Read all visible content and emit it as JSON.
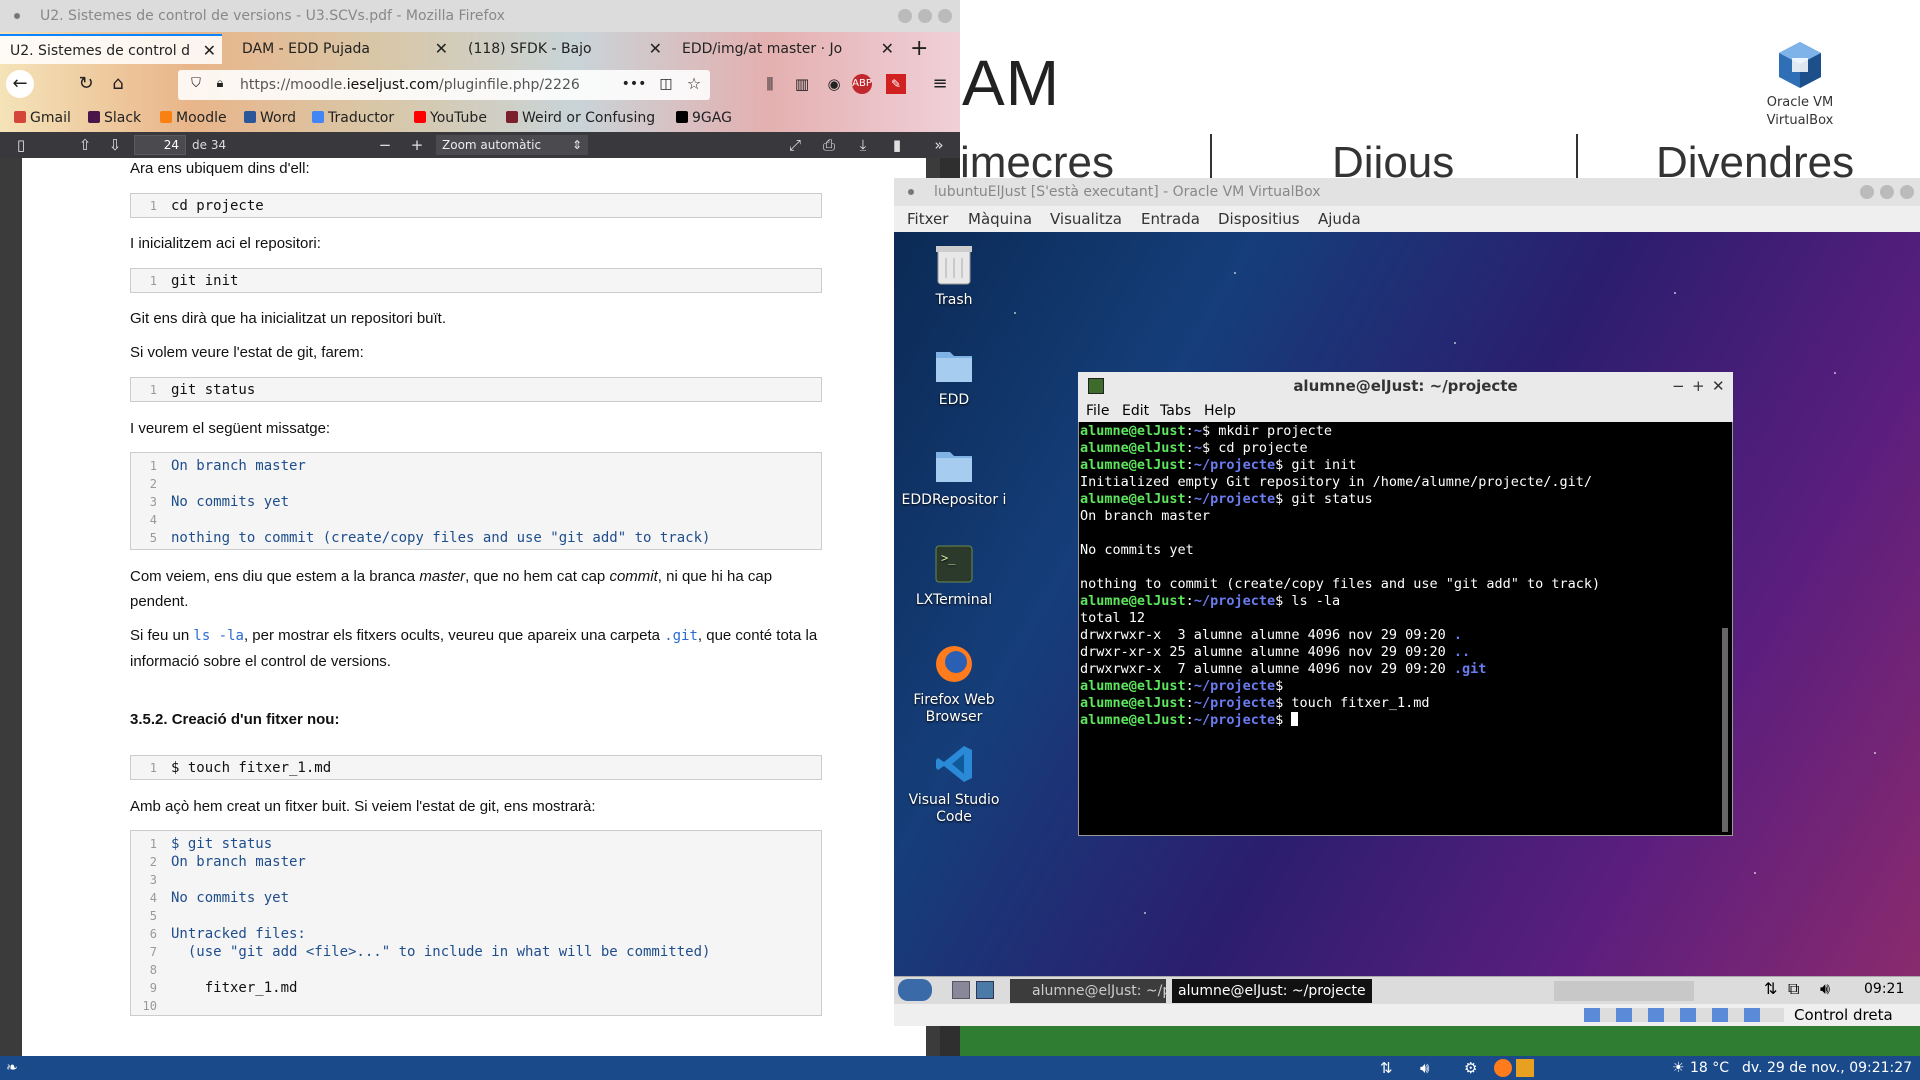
{
  "background": {
    "title_fragment": "AM",
    "days": [
      "imecres",
      "Dijous",
      "Divendres"
    ],
    "vbox_icon_label_1": "Oracle VM",
    "vbox_icon_label_2": "VirtualBox"
  },
  "firefox": {
    "window_title": "U2. Sistemes de control de versions - U3.SCVs.pdf - Mozilla Firefox",
    "tabs": [
      {
        "label": "U2. Sistemes de control d"
      },
      {
        "label": "DAM - EDD Pujada"
      },
      {
        "label": "(118) SFDK - Bajo"
      },
      {
        "label": "EDD/img/at master · Jo"
      }
    ],
    "url_prefix": "https://moodle.",
    "url_domain": "ieseljust.com",
    "url_suffix": "/pluginfile.php/2226",
    "url_more": "•••",
    "bookmarks": [
      "Gmail",
      "Slack",
      "Moodle",
      "Word",
      "Traductor",
      "YouTube",
      "Weird or Confusing",
      "9GAG"
    ]
  },
  "pdf": {
    "page_number": "24",
    "page_count": "de 34",
    "zoom": "Zoom automàtic",
    "p1": "Ara ens ubiquem dins d'ell:",
    "code1": "cd projecte",
    "p2": "I inicialitzem aci el repositori:",
    "code2": "git init",
    "p3": "Git ens dirà que ha inicialitzat un repositori buït.",
    "p4": "Si volem veure l'estat de git, farem:",
    "code3": "git status",
    "p5": "I veurem el següent missatge:",
    "code4": [
      "On branch master",
      "",
      "No commits yet",
      "",
      "nothing to commit (create/copy files and use \"git add\" to track)"
    ],
    "p6a": "Com veiem, ens diu que estem a la branca ",
    "p6b": "master",
    "p6c": ", que no hem cat cap ",
    "p6d": "commit",
    "p6e": ", ni que hi ha cap pendent.",
    "p7a": "Si feu un ",
    "p7b": "ls -la",
    "p7c": ", per mostrar els fitxers ocults, veureu que apareix una carpeta ",
    "p7d": ".git",
    "p7e": ", que conté tota la informació sobre el control de versions.",
    "heading": "3.5.2. Creació d'un fitxer nou:",
    "code5": "$ touch fitxer_1.md",
    "p8": "Amb açò hem creat un fitxer buit. Si veiem l'estat de git, ens mostrarà:",
    "code6": [
      "$ git status",
      "On branch master",
      "",
      "No commits yet",
      "",
      "Untracked files:",
      "  (use \"git add <file>...\" to include in what will be committed)",
      "",
      "    fitxer_1.md",
      ""
    ]
  },
  "vbox": {
    "window_title": "lubuntuElJust [S'està executant] - Oracle VM VirtualBox",
    "menu": [
      "Fitxer",
      "Màquina",
      "Visualitza",
      "Entrada",
      "Dispositius",
      "Ajuda"
    ],
    "desktop_icons": [
      {
        "label": "Trash"
      },
      {
        "label": "EDD"
      },
      {
        "label": "EDDRepositor i"
      },
      {
        "label": "LXTerminal"
      },
      {
        "label": "Firefox Web Browser"
      },
      {
        "label": "Visual Studio Code"
      }
    ],
    "taskbar_item": "alumne@elJust: ~/pr",
    "taskbar_tooltip": "alumne@elJust: ~/projecte",
    "guest_clock": "09:21",
    "host_key": "Control dreta"
  },
  "terminal": {
    "title": "alumne@elJust: ~/projecte",
    "menu": [
      "File",
      "Edit",
      "Tabs",
      "Help"
    ],
    "prompt_user": "alumne@elJust",
    "lines": [
      {
        "type": "cmd",
        "path": "~",
        "cmd": "$ mkdir projecte"
      },
      {
        "type": "cmd",
        "path": "~",
        "cmd": "$ cd projecte"
      },
      {
        "type": "cmd",
        "path": "~/projecte",
        "cmd": "$ git init"
      },
      {
        "type": "out",
        "text": "Initialized empty Git repository in /home/alumne/projecte/.git/"
      },
      {
        "type": "cmd",
        "path": "~/projecte",
        "cmd": "$ git status"
      },
      {
        "type": "out",
        "text": "On branch master"
      },
      {
        "type": "out",
        "text": ""
      },
      {
        "type": "out",
        "text": "No commits yet"
      },
      {
        "type": "out",
        "text": ""
      },
      {
        "type": "out",
        "text": "nothing to commit (create/copy files and use \"git add\" to track)"
      },
      {
        "type": "cmd",
        "path": "~/projecte",
        "cmd": "$ ls -la"
      },
      {
        "type": "out",
        "text": "total 12"
      },
      {
        "type": "ls",
        "text": "drwxrwxr-x  3 alumne alumne 4096 nov 29 09:20 ",
        "name": "."
      },
      {
        "type": "ls",
        "text": "drwxr-xr-x 25 alumne alumne 4096 nov 29 09:20 ",
        "name": ".."
      },
      {
        "type": "ls",
        "text": "drwxrwxr-x  7 alumne alumne 4096 nov 29 09:20 ",
        "name": ".git"
      },
      {
        "type": "cmd",
        "path": "~/projecte",
        "cmd": "$"
      },
      {
        "type": "cmd",
        "path": "~/projecte",
        "cmd": "$ touch fitxer_1.md"
      },
      {
        "type": "cmd",
        "path": "~/projecte",
        "cmd": "$ "
      }
    ]
  },
  "host_taskbar": {
    "temperature": "18 °C",
    "datetime": "dv. 29 de nov., 09:21:27"
  }
}
